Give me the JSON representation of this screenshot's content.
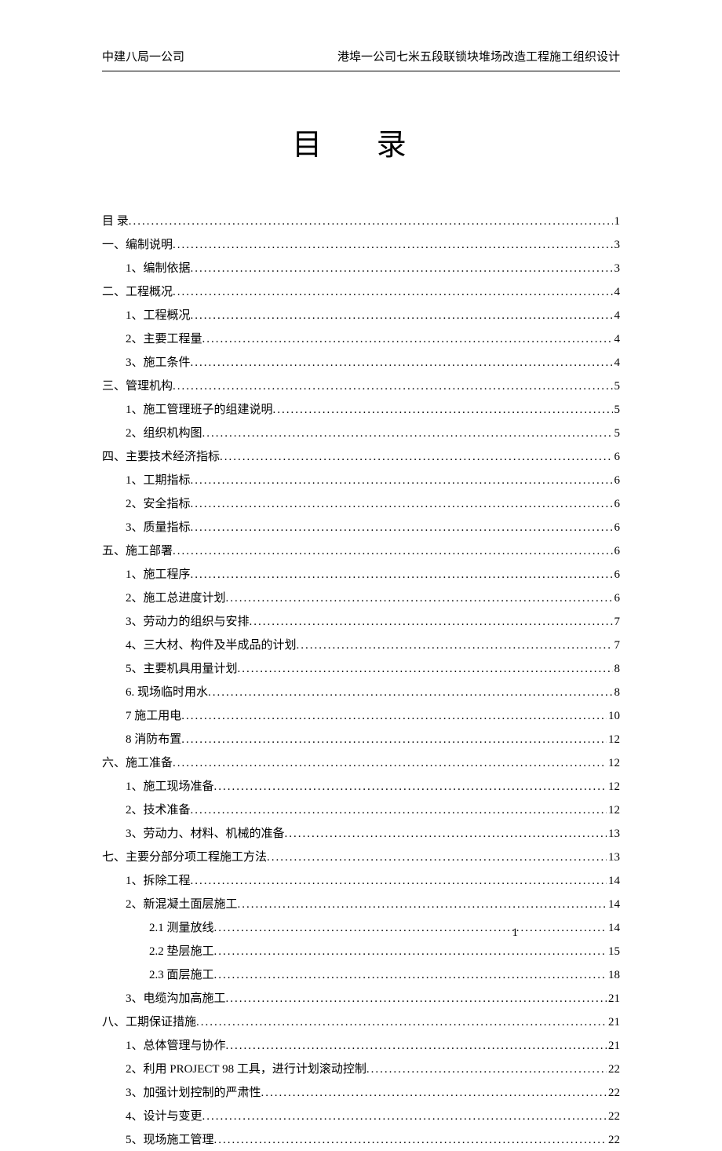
{
  "header": {
    "left": "中建八局一公司",
    "right": "港埠一公司七米五段联锁块堆场改造工程施工组织设计"
  },
  "title": "目   录",
  "toc": [
    {
      "label": "目    录",
      "page": "1",
      "indent": 0
    },
    {
      "label": "一、编制说明",
      "page": "3",
      "indent": 0
    },
    {
      "label": "1、编制依据",
      "page": "3",
      "indent": 1
    },
    {
      "label": "二、工程概况",
      "page": "4",
      "indent": 0
    },
    {
      "label": "1、工程概况",
      "page": "4",
      "indent": 1
    },
    {
      "label": "2、主要工程量",
      "page": "4",
      "indent": 1
    },
    {
      "label": "3、施工条件",
      "page": "4",
      "indent": 1
    },
    {
      "label": "三、管理机构",
      "page": "5",
      "indent": 0
    },
    {
      "label": "1、施工管理班子的组建说明",
      "page": "5",
      "indent": 1
    },
    {
      "label": "2、组织机构图",
      "page": "5",
      "indent": 1
    },
    {
      "label": "四、主要技术经济指标",
      "page": "6",
      "indent": 0
    },
    {
      "label": "1、工期指标",
      "page": "6",
      "indent": 1
    },
    {
      "label": "2、安全指标",
      "page": "6",
      "indent": 1
    },
    {
      "label": "3、质量指标",
      "page": "6",
      "indent": 1
    },
    {
      "label": "五、施工部署",
      "page": "6",
      "indent": 0
    },
    {
      "label": "1、施工程序",
      "page": "6",
      "indent": 1
    },
    {
      "label": "2、施工总进度计划",
      "page": "6",
      "indent": 1
    },
    {
      "label": "3、劳动力的组织与安排",
      "page": "7",
      "indent": 1
    },
    {
      "label": "4、三大材、构件及半成品的计划",
      "page": "7",
      "indent": 1
    },
    {
      "label": "5、主要机具用量计划",
      "page": "8",
      "indent": 1
    },
    {
      "label": "6. 现场临时用水",
      "page": "8",
      "indent": 1
    },
    {
      "label": "7 施工用电",
      "page": "10",
      "indent": 1
    },
    {
      "label": "8 消防布置",
      "page": "12",
      "indent": 1
    },
    {
      "label": "六、施工准备",
      "page": "12",
      "indent": 0
    },
    {
      "label": "1、施工现场准备",
      "page": "12",
      "indent": 1
    },
    {
      "label": "2、技术准备",
      "page": "12",
      "indent": 1
    },
    {
      "label": "3、劳动力、材料、机械的准备",
      "page": "13",
      "indent": 1
    },
    {
      "label": "七、主要分部分项工程施工方法",
      "page": "13",
      "indent": 0
    },
    {
      "label": "1、拆除工程",
      "page": "14",
      "indent": 1
    },
    {
      "label": "2、新混凝土面层施工",
      "page": "14",
      "indent": 1
    },
    {
      "label": "2.1 测量放线",
      "page": "14",
      "indent": 2
    },
    {
      "label": "2.2 垫层施工",
      "page": "15",
      "indent": 2
    },
    {
      "label": "2.3 面层施工",
      "page": "18",
      "indent": 2
    },
    {
      "label": "3、电缆沟加高施工",
      "page": "21",
      "indent": 1
    },
    {
      "label": "八、工期保证措施",
      "page": "21",
      "indent": 0
    },
    {
      "label": "1、总体管理与协作",
      "page": "21",
      "indent": 1
    },
    {
      "label": "2、利用 PROJECT 98 工具，进行计划滚动控制",
      "page": "22",
      "indent": 1
    },
    {
      "label": "3、加强计划控制的严肃性",
      "page": "22",
      "indent": 1
    },
    {
      "label": "4、设计与变更",
      "page": "22",
      "indent": 1
    },
    {
      "label": "5、现场施工管理",
      "page": "22",
      "indent": 1
    }
  ],
  "footer": {
    "pageNumber": "1"
  }
}
